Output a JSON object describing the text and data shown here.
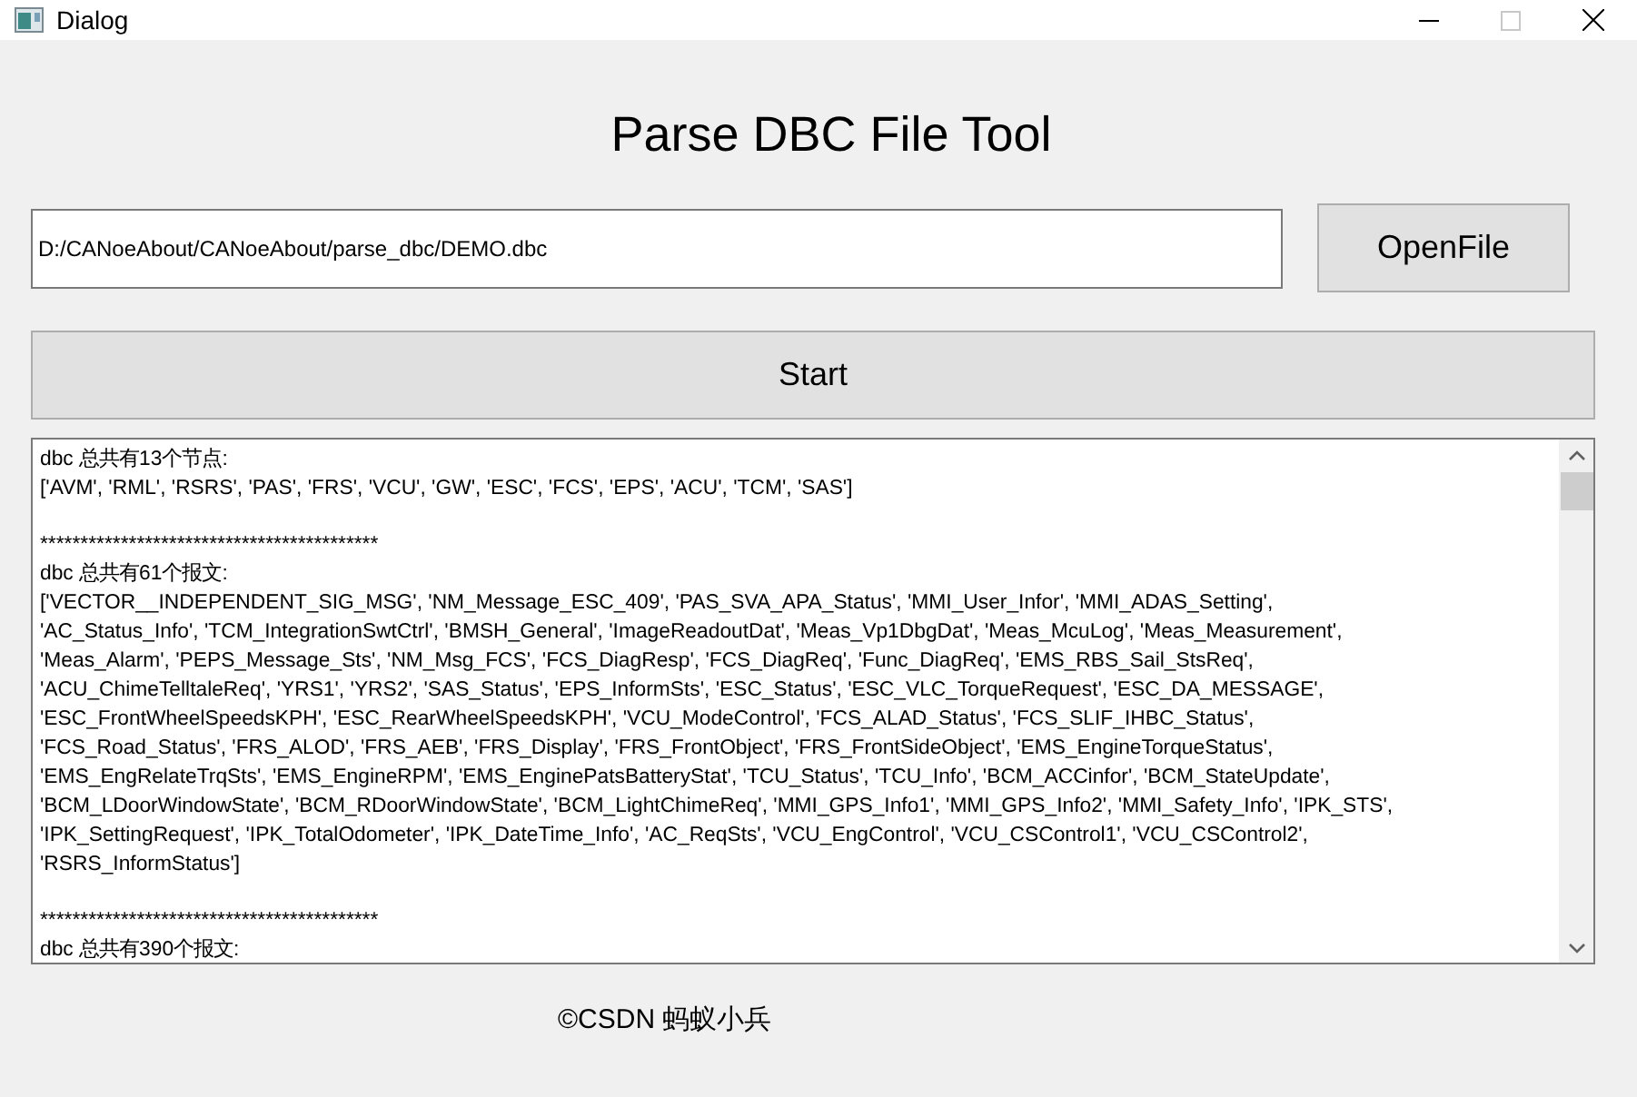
{
  "window": {
    "title": "Dialog"
  },
  "heading": "Parse DBC File Tool",
  "file_path": {
    "value": "D:/CANoeAbout/CANoeAbout/parse_dbc/DEMO.dbc"
  },
  "buttons": {
    "open_file": "OpenFile",
    "start": "Start"
  },
  "output": {
    "blocks": [
      {
        "lines": [
          "dbc 总共有13个节点:",
          "['AVM', 'RML', 'RSRS', 'PAS', 'FRS', 'VCU', 'GW', 'ESC', 'FCS', 'EPS', 'ACU', 'TCM', 'SAS']"
        ]
      },
      {
        "lines": [
          "******************************************",
          "dbc 总共有61个报文:",
          "['VECTOR__INDEPENDENT_SIG_MSG', 'NM_Message_ESC_409', 'PAS_SVA_APA_Status', 'MMI_User_Infor', 'MMI_ADAS_Setting',",
          "'AC_Status_Info', 'TCM_IntegrationSwtCtrl', 'BMSH_General', 'ImageReadoutDat', 'Meas_Vp1DbgDat', 'Meas_McuLog', 'Meas_Measurement',",
          "'Meas_Alarm', 'PEPS_Message_Sts', 'NM_Msg_FCS', 'FCS_DiagResp', 'FCS_DiagReq', 'Func_DiagReq', 'EMS_RBS_Sail_StsReq',",
          "'ACU_ChimeTelltaleReq', 'YRS1', 'YRS2', 'SAS_Status', 'EPS_InformSts', 'ESC_Status', 'ESC_VLC_TorqueRequest', 'ESC_DA_MESSAGE',",
          "'ESC_FrontWheelSpeedsKPH', 'ESC_RearWheelSpeedsKPH', 'VCU_ModeControl', 'FCS_ALAD_Status', 'FCS_SLIF_IHBC_Status',",
          "'FCS_Road_Status', 'FRS_ALOD', 'FRS_AEB', 'FRS_Display', 'FRS_FrontObject', 'FRS_FrontSideObject', 'EMS_EngineTorqueStatus',",
          "'EMS_EngRelateTrqSts', 'EMS_EngineRPM', 'EMS_EnginePatsBatteryStat', 'TCU_Status', 'TCU_Info', 'BCM_ACCinfor', 'BCM_StateUpdate',",
          "'BCM_LDoorWindowState', 'BCM_RDoorWindowState', 'BCM_LightChimeReq', 'MMI_GPS_Info1', 'MMI_GPS_Info2', 'MMI_Safety_Info', 'IPK_STS',",
          "'IPK_SettingRequest', 'IPK_TotalOdometer', 'IPK_DateTime_Info', 'AC_ReqSts', 'VCU_EngControl', 'VCU_CSControl1', 'VCU_CSControl2',",
          "'RSRS_InformStatus']"
        ]
      },
      {
        "lines": [
          "******************************************",
          "dbc 总共有390个报文:"
        ]
      }
    ]
  },
  "footer": "©CSDN 蚂蚁小兵"
}
